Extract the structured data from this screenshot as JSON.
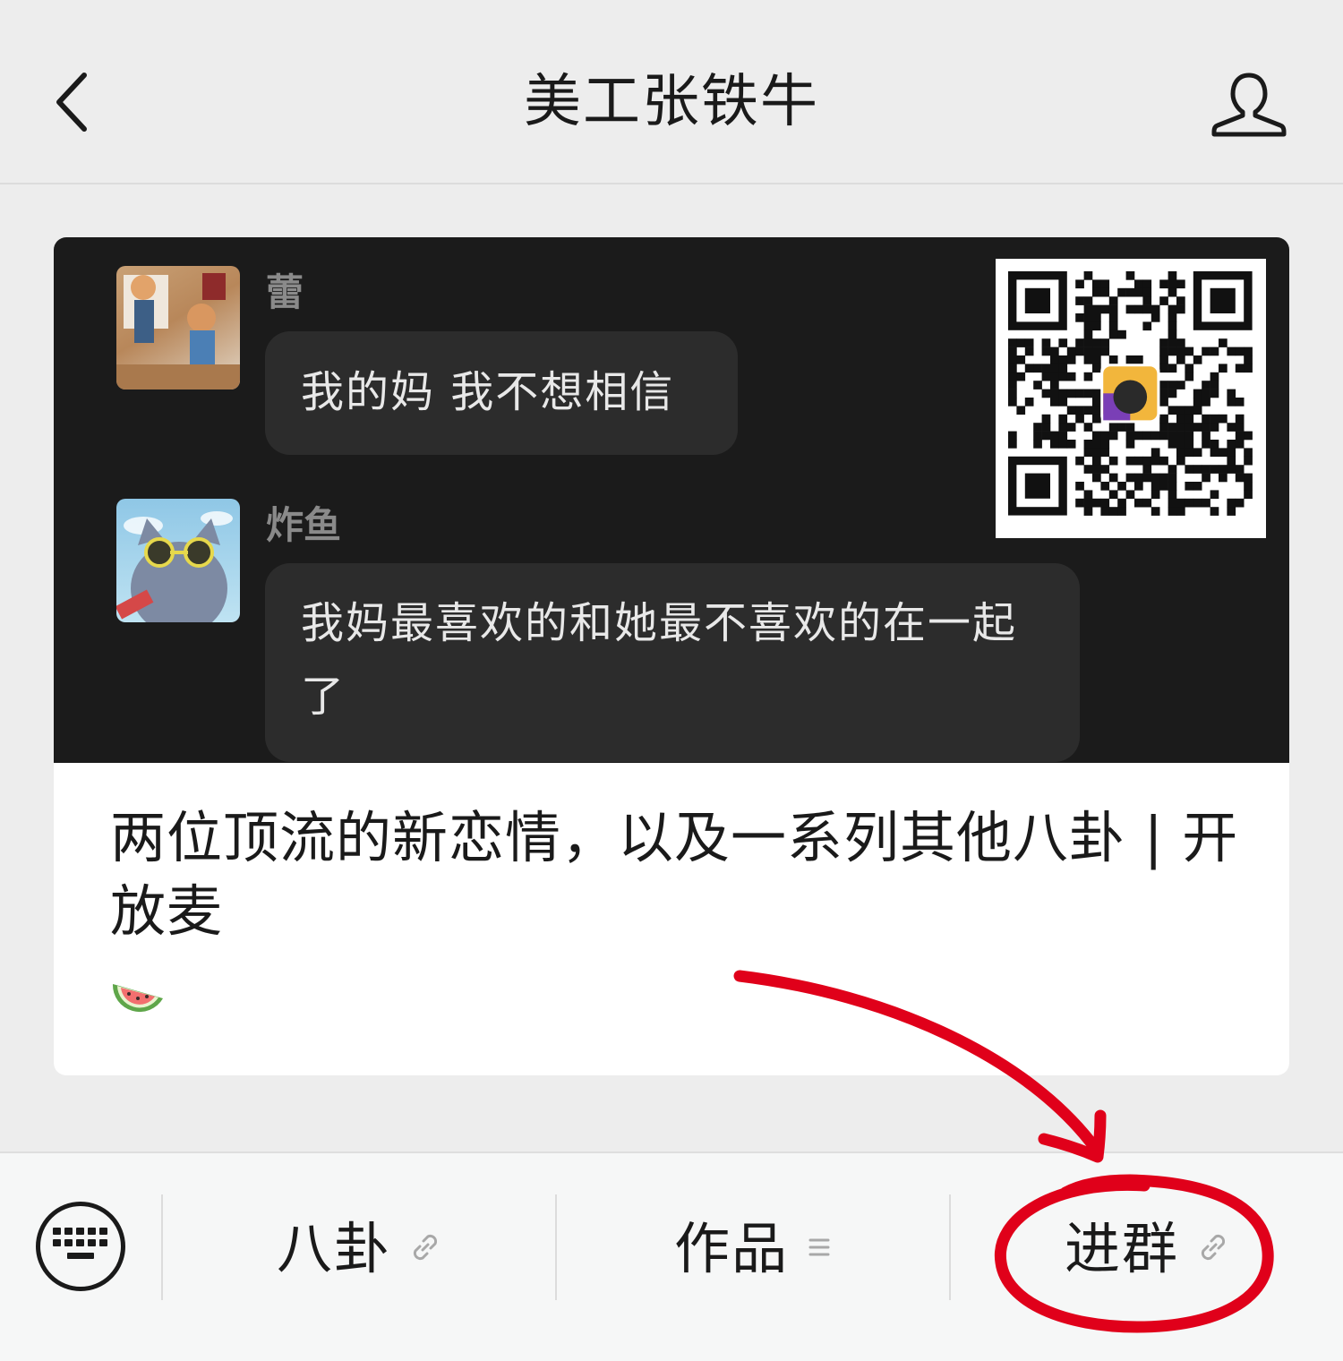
{
  "header": {
    "title": "美工张铁牛",
    "back_icon": "chevron-left-icon",
    "profile_icon": "person-icon"
  },
  "article": {
    "cover": {
      "messages": [
        {
          "sender": "蕾",
          "text": "我的妈 我不想相信"
        },
        {
          "sender": "炸鱼",
          "text": "我妈最喜欢的和她最不喜欢的在一起了"
        }
      ],
      "qr_icon": "qr-code"
    },
    "title": "两位顶流的新恋情，以及一系列其他八卦 | 开放麦",
    "emoji": "watermelon-emoji"
  },
  "bottom_menu": {
    "keyboard_icon": "keyboard-icon",
    "items": [
      {
        "label": "八卦",
        "icon": "link-icon"
      },
      {
        "label": "作品",
        "icon": "menu-lines-icon"
      },
      {
        "label": "进群",
        "icon": "link-icon"
      }
    ]
  },
  "colors": {
    "background": "#ededed",
    "cover_bg": "#1b1b1b",
    "bubble_bg": "#2c2c2c",
    "annotation": "#e0001a"
  }
}
